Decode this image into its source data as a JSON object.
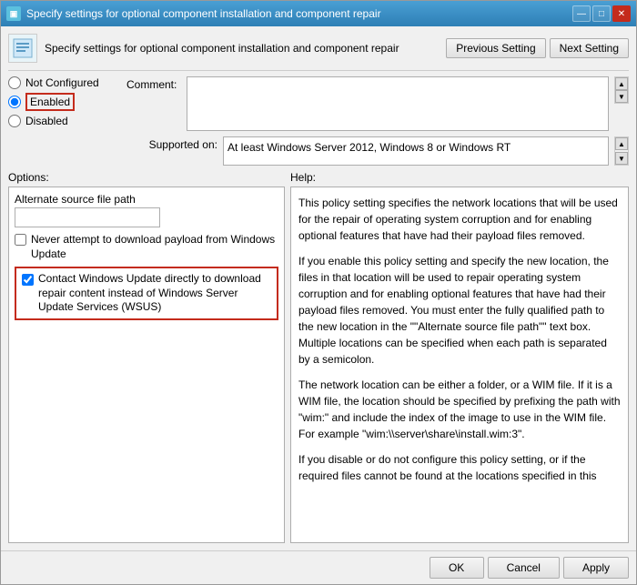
{
  "window": {
    "title": "Specify settings for optional component installation and component repair",
    "icon_label": "GP",
    "controls": {
      "minimize": "—",
      "maximize": "□",
      "close": "✕"
    }
  },
  "header": {
    "icon_text": "GP",
    "description": "Specify settings for optional component installation and component repair",
    "prev_button": "Previous Setting",
    "next_button": "Next Setting"
  },
  "radio": {
    "not_configured": "Not Configured",
    "enabled": "Enabled",
    "disabled": "Disabled",
    "selected": "enabled"
  },
  "comment": {
    "label": "Comment:"
  },
  "supported": {
    "label": "Supported on:",
    "value": "At least Windows Server 2012, Windows 8 or Windows RT"
  },
  "options": {
    "label": "Options:",
    "alt_source_label": "Alternate source file path",
    "alt_source_placeholder": "",
    "never_attempt_label": "Never attempt to download payload from Windows Update",
    "windows_update_label": "Contact Windows Update directly to download repair content instead of Windows Server Update Services (WSUS)"
  },
  "help": {
    "label": "Help:",
    "paragraphs": [
      "This policy setting specifies the network locations that will be used for the repair of operating system corruption and for enabling optional features that have had their payload files removed.",
      "If you enable this policy setting and specify the new location, the files in that location will be used to repair operating system corruption and for enabling optional features that have had their payload files removed. You must enter the fully qualified path to the new location in the \"\"Alternate source file path\"\" text box. Multiple locations can be specified when each path is separated by a semicolon.",
      "The network location can be either a folder, or a WIM file. If it is a WIM file, the location should be specified by prefixing the path with \"wim:\" and include the index of the image to use in the WIM file. For example \"wim:\\\\server\\share\\install.wim:3\".",
      "If you disable or do not configure this policy setting, or if the required files cannot be found at the locations specified in this"
    ]
  },
  "footer": {
    "ok": "OK",
    "cancel": "Cancel",
    "apply": "Apply"
  }
}
